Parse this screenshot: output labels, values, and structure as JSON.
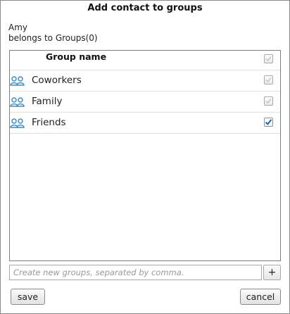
{
  "dialog": {
    "title": "Add contact to groups",
    "contact_name": "Amy",
    "belongs_text": "belongs to Groups(0)"
  },
  "list": {
    "header_label": "Group name",
    "groups": [
      {
        "label": "Coworkers",
        "checked": true,
        "disabled": true,
        "icon": "people-icon"
      },
      {
        "label": "Family",
        "checked": true,
        "disabled": true,
        "icon": "people-icon"
      },
      {
        "label": "Friends",
        "checked": true,
        "disabled": false,
        "icon": "people-icon"
      }
    ]
  },
  "new_groups": {
    "placeholder": "Create new groups, separated by comma.",
    "value": ""
  },
  "buttons": {
    "add_label": "+",
    "save_label": "save",
    "cancel_label": "cancel"
  },
  "colors": {
    "icon_blue": "#3a8fd0",
    "checkmark_enabled": "#1f5f99",
    "checkmark_disabled": "#c9c9c9",
    "row_divider": "#d6e4ee"
  }
}
